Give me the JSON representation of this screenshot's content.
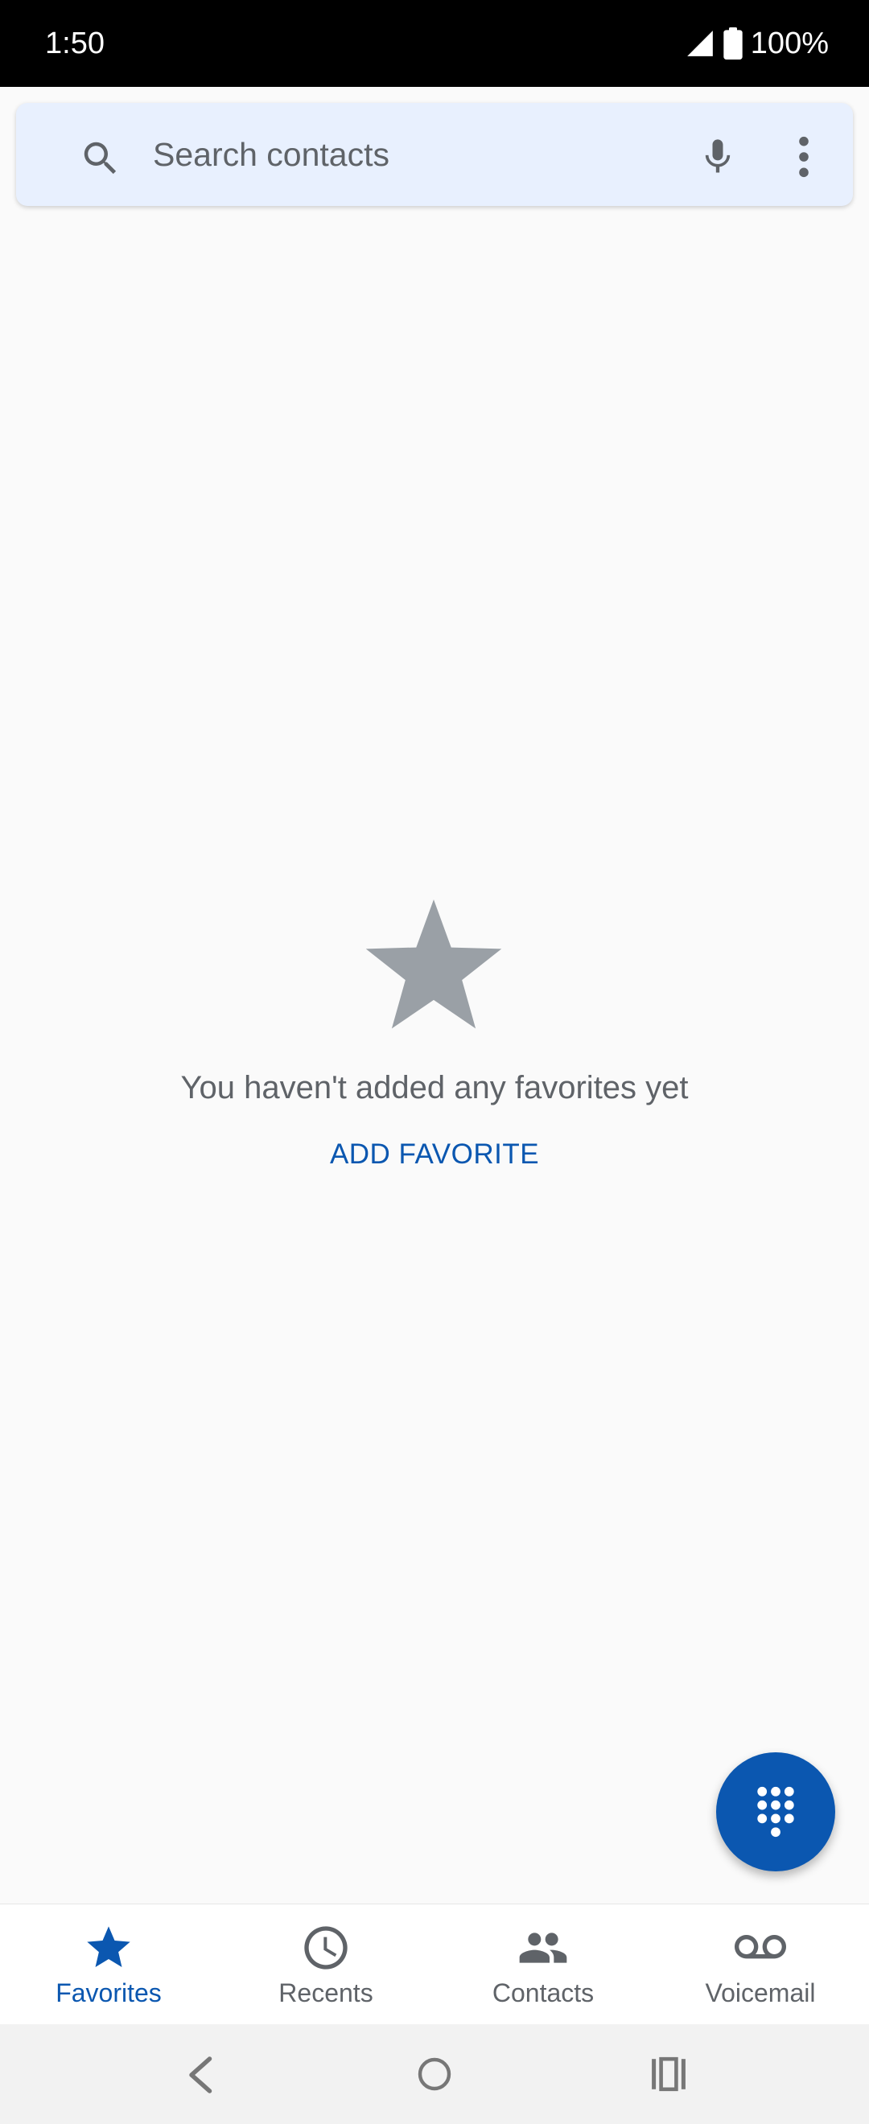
{
  "status_bar": {
    "time": "1:50",
    "battery_text": "100%",
    "icons": [
      "signal-icon",
      "battery-icon"
    ]
  },
  "search": {
    "placeholder": "Search contacts",
    "icons": [
      "search-icon",
      "mic-icon",
      "more-vert-icon"
    ]
  },
  "empty_state": {
    "icon": "star-icon",
    "message": "You haven't added any favorites yet",
    "action_label": "ADD FAVORITE"
  },
  "fab": {
    "icon": "dialpad-icon"
  },
  "bottom_nav": {
    "items": [
      {
        "label": "Favorites",
        "icon": "star-icon",
        "active": true
      },
      {
        "label": "Recents",
        "icon": "clock-icon",
        "active": false
      },
      {
        "label": "Contacts",
        "icon": "people-icon",
        "active": false
      },
      {
        "label": "Voicemail",
        "icon": "voicemail-icon",
        "active": false
      }
    ]
  },
  "system_nav": {
    "icons": [
      "back-icon",
      "home-icon",
      "recents-icon"
    ]
  },
  "colors": {
    "accent": "#0b57b0",
    "search_bg": "#e8f0fe",
    "icon_gray": "#5f6368",
    "star_gray": "#9aa0a6",
    "background": "#fafafa"
  }
}
